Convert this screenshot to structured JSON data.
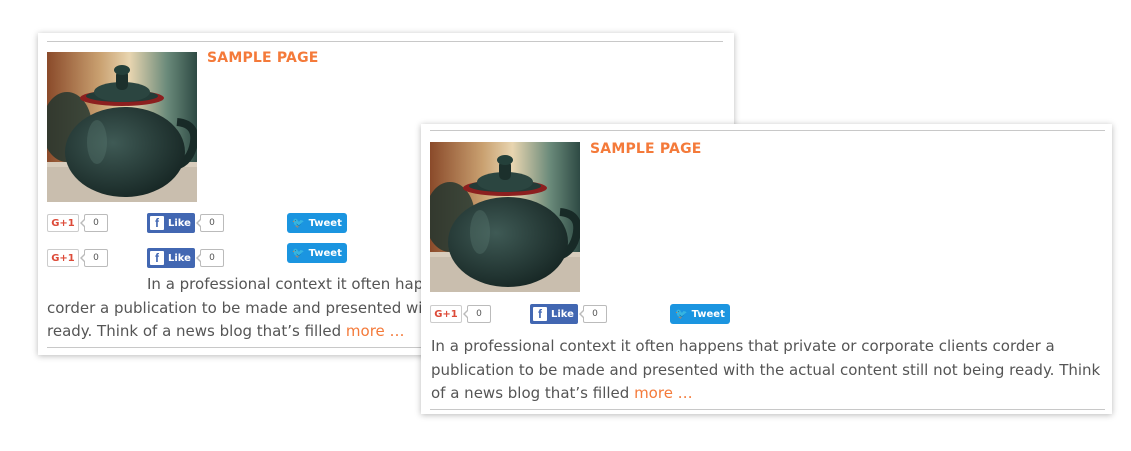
{
  "cards": [
    {
      "title": "SAMPLE PAGE",
      "share_rows": [
        {
          "gplus_label": "G+1",
          "gplus_count": "0",
          "fb_label": "Like",
          "fb_count": "0",
          "tweet_label": "Tweet"
        },
        {
          "gplus_label": "G+1",
          "gplus_count": "0",
          "fb_label": "Like",
          "fb_count": "0",
          "tweet_label": "Tweet"
        }
      ],
      "excerpt_lines": [
        "In a professional context it often happens that private or corporate clients",
        "corder a publication to be made and presented with the actual content still not being",
        "ready. Think of a news blog that’s filled"
      ],
      "more_label": "more …"
    },
    {
      "title": "SAMPLE PAGE",
      "share_rows": [
        {
          "gplus_label": "G+1",
          "gplus_count": "0",
          "fb_label": "Like",
          "fb_count": "0",
          "tweet_label": "Tweet"
        }
      ],
      "excerpt_lines": [
        "In a professional context it often happens that private or corporate clients corder a",
        "publication to be made and presented with the actual content still not being ready. Think",
        "of a news blog that’s filled"
      ],
      "more_label": "more …"
    }
  ],
  "colors": {
    "accent": "#f47a3a",
    "facebook": "#4267b2",
    "twitter": "#1b95e0",
    "gplus": "#dd4b39"
  },
  "icons": [
    "teapot-image",
    "facebook-icon",
    "twitter-bird-icon"
  ]
}
